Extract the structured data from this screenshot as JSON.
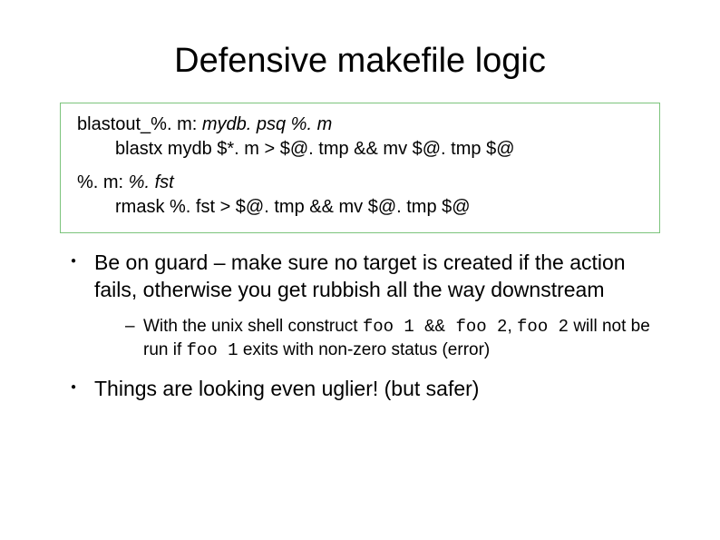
{
  "title": "Defensive makefile logic",
  "code": {
    "rule1_target_a": "blastout_%. m:",
    "rule1_target_b": " mydb. psq %. m",
    "rule1_cmd_a": "blastx mydb $*. m",
    "rule1_cmd_b": " > $@. tmp && mv $@. tmp   $@",
    "rule2_target_a": "%. m:",
    "rule2_target_b": " %. fst",
    "rule2_cmd_a": "rmask %. fst",
    "rule2_cmd_b": " > $@. tmp && mv $@. tmp   $@"
  },
  "bullets": {
    "b1": "Be on guard – make sure no target is created if the action fails, otherwise you get rubbish all the way downstream",
    "sub_pre": "With the unix shell construct ",
    "sub_code1": "foo 1 && foo 2",
    "sub_mid1": ", ",
    "sub_code2": "foo 2",
    "sub_mid2": " will not be run if ",
    "sub_code3": "foo 1",
    "sub_post": " exits with non-zero status (error)",
    "b2": "Things are looking even uglier! (but safer)"
  }
}
